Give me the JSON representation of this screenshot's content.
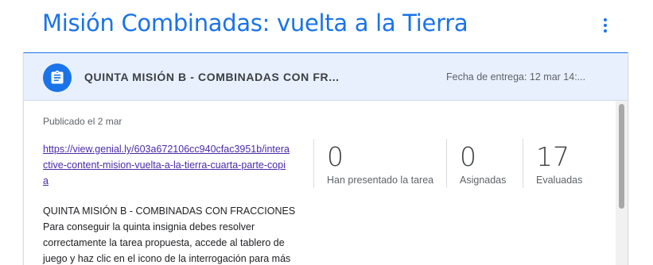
{
  "topic": {
    "title": "Misión Combinadas: vuelta a la Tierra",
    "menu_icon": "more-vert-icon"
  },
  "assignment": {
    "icon": "assignment-icon",
    "title": "QUINTA MISIÓN B - COMBINADAS CON FR...",
    "due_date": "Fecha de entrega: 12 mar 14:...",
    "published": "Publicado el 2 mar",
    "link": "https://view.genial.ly/603a672106cc940cfac3951b/interactive-content-mision-vuelta-a-la-tierra-cuarta-parte-copia",
    "stats": [
      {
        "value": "0",
        "label": "Han presentado la tarea"
      },
      {
        "value": "0",
        "label": "Asignadas"
      },
      {
        "value": "17",
        "label": "Evaluadas"
      }
    ],
    "description": "QUINTA MISIÓN B - COMBINADAS CON FRACCIONES Para conseguir la quinta insignia debes resolver correctamente la tarea propuesta, accede al tablero de juego y haz clic en el icono de la interrogación para más"
  },
  "colors": {
    "accent": "#1a73e8",
    "header_bg": "#e8f0fe",
    "link": "#4a2aa8"
  }
}
